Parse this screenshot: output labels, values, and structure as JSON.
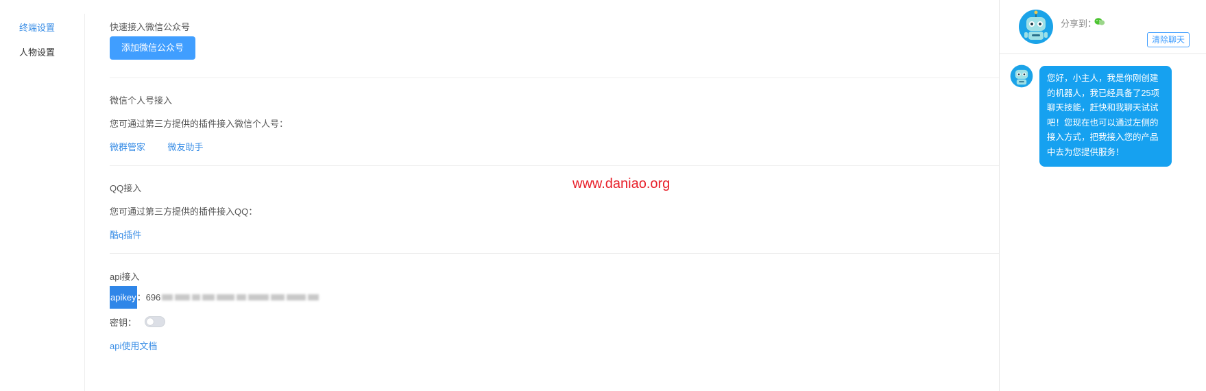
{
  "sidebar": {
    "items": [
      {
        "label": "终端设置"
      },
      {
        "label": "人物设置"
      }
    ]
  },
  "wechat_official": {
    "title": "快速接入微信公众号",
    "button_label": "添加微信公众号"
  },
  "wechat_personal": {
    "title": "微信个人号接入",
    "desc": "您可通过第三方提供的插件接入微信个人号：",
    "links": [
      "微群管家",
      "微友助手"
    ]
  },
  "qq": {
    "title": "QQ接入",
    "desc": "您可通过第三方提供的插件接入QQ：",
    "link": "酷q插件"
  },
  "api": {
    "title": "api接入",
    "apikey_label": "apikey",
    "apikey_sep": "：",
    "apikey_prefix": "696",
    "secret_label": "密钥：",
    "secret_enabled": false,
    "doc_link": "api使用文档"
  },
  "watermark": "www.daniao.org",
  "chat": {
    "share_label": "分享到：",
    "clear_label": "清除聊天",
    "message": "您好，小主人，我是你刚创建的机器人，我已经具备了25项聊天技能，赶快和我聊天试试吧！您现在也可以通过左侧的接入方式，把我接入您的产品中去为您提供服务！"
  },
  "colors": {
    "accent": "#409eff",
    "link": "#3a8ee6",
    "bubble": "#16a1f0",
    "watermark": "#e8202a",
    "robot": "#1ba3e8"
  },
  "icons": {
    "avatar": "robot-avatar-icon",
    "share": "wechat-share-icon"
  }
}
